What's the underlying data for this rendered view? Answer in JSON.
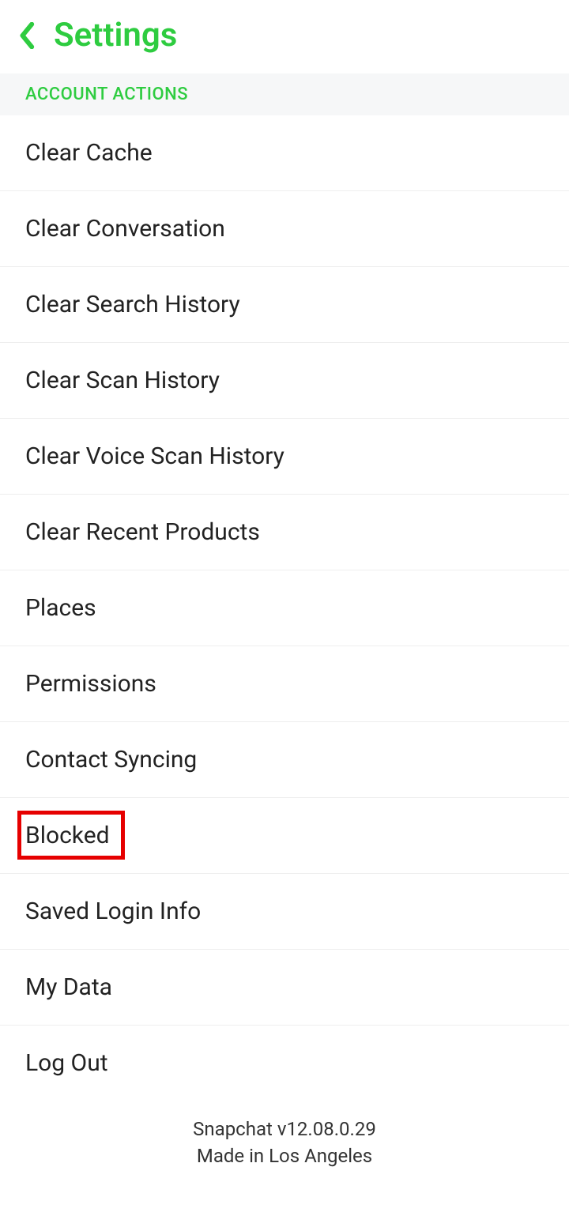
{
  "header": {
    "title": "Settings"
  },
  "section": {
    "label": "ACCOUNT ACTIONS"
  },
  "items": [
    {
      "label": "Clear Cache"
    },
    {
      "label": "Clear Conversation"
    },
    {
      "label": "Clear Search History"
    },
    {
      "label": "Clear Scan History"
    },
    {
      "label": "Clear Voice Scan History"
    },
    {
      "label": "Clear Recent Products"
    },
    {
      "label": "Places"
    },
    {
      "label": "Permissions"
    },
    {
      "label": "Contact Syncing"
    },
    {
      "label": "Blocked",
      "highlighted": true
    },
    {
      "label": "Saved Login Info"
    },
    {
      "label": "My Data"
    },
    {
      "label": "Log Out"
    }
  ],
  "footer": {
    "version": "Snapchat v12.08.0.29",
    "made_in": "Made in Los Angeles"
  }
}
